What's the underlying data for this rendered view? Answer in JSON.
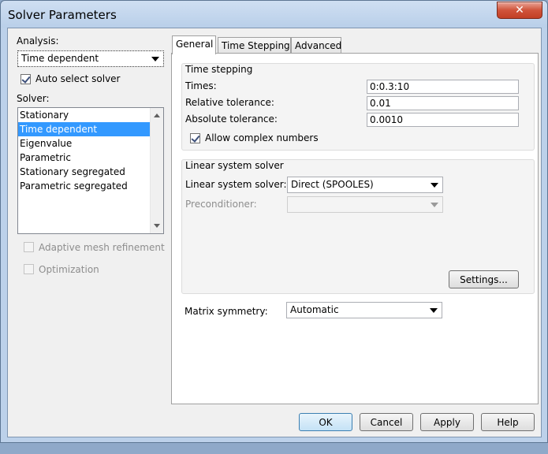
{
  "window": {
    "title": "Solver Parameters",
    "close_glyph": "✕"
  },
  "left": {
    "analysis_label": "Analysis:",
    "analysis_value": "Time dependent",
    "auto_select_label": "Auto select solver",
    "auto_select_checked": true,
    "solver_label": "Solver:",
    "solver_items": [
      "Stationary",
      "Time dependent",
      "Eigenvalue",
      "Parametric",
      "Stationary segregated",
      "Parametric segregated"
    ],
    "solver_selected": "Time dependent",
    "adaptive_label": "Adaptive mesh refinement",
    "optimization_label": "Optimization"
  },
  "tabs": [
    "General",
    "Time Stepping",
    "Advanced"
  ],
  "active_tab": "General",
  "general": {
    "time_stepping_title": "Time stepping",
    "times_label": "Times:",
    "times_value": "0:0.3:10",
    "reltol_label": "Relative tolerance:",
    "reltol_value": "0.01",
    "abstol_label": "Absolute tolerance:",
    "abstol_value": "0.0010",
    "complex_label": "Allow complex numbers",
    "complex_checked": true,
    "linear_title": "Linear system solver",
    "linear_solver_label": "Linear system solver:",
    "linear_solver_value": "Direct (SPOOLES)",
    "preconditioner_label": "Preconditioner:",
    "preconditioner_value": "",
    "settings_button": "Settings...",
    "matrix_label": "Matrix symmetry:",
    "matrix_value": "Automatic"
  },
  "buttons": {
    "ok": "OK",
    "cancel": "Cancel",
    "apply": "Apply",
    "help": "Help"
  },
  "colors": {
    "selection": "#3399ff",
    "titlebar": "#bcd1ea",
    "close": "#c94a32"
  }
}
